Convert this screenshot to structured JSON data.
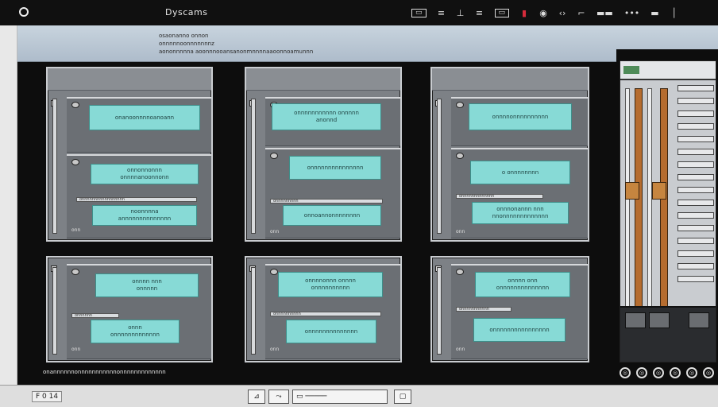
{
  "window": {
    "title": "Dyscams"
  },
  "toolbar": {
    "icons": [
      {
        "name": "layout-icon",
        "glyph": "▭"
      },
      {
        "name": "list-icon",
        "glyph": "≡"
      },
      {
        "name": "pin-icon",
        "glyph": "⊥"
      },
      {
        "name": "menu-icon",
        "glyph": "≡"
      },
      {
        "name": "window-icon",
        "glyph": "▭"
      },
      {
        "name": "record-icon",
        "glyph": "▮"
      },
      {
        "name": "eye-icon",
        "glyph": "◉"
      },
      {
        "name": "back-icon",
        "glyph": "‹›"
      },
      {
        "name": "flag-icon",
        "glyph": "⌐"
      },
      {
        "name": "dots-icon",
        "glyph": "▬▬"
      },
      {
        "name": "more-icon",
        "glyph": "•••"
      },
      {
        "name": "maximize-icon",
        "glyph": "▬"
      },
      {
        "name": "scroll-icon",
        "glyph": "│"
      }
    ]
  },
  "header": {
    "line1": "osaonanno onnon",
    "line2": "onnnnnoonnnnnnnz",
    "line3": "aononnnnna aoonnnooansanonmnnnnaaoonnoamunnn"
  },
  "cards": [
    {
      "top": "onanoonnnnoanoann",
      "mid": "onnonnonnn\nonnnnanoonnonn",
      "low": "noonnnna\nannnnnnnnnnnnnn",
      "strip": "onnnnnnnnnnnnnnnnn",
      "tiny": "onn"
    },
    {
      "top": "onnnnnnnnnnn onnnnn\nanonnd",
      "mid": "onnnnnnnnnnnnnnn",
      "low": "onnoannonnnnnnnn",
      "strip": "onnnnnnnnn",
      "tiny": "onn"
    },
    {
      "top": "onnnnonnnnnnnnnn",
      "mid": "o onnnnnnnn",
      "low": "onnnonannn nnn\nnnonnnnnnnnnnnnn",
      "strip": "onnnnnnnnnnnnn",
      "tiny": "onn"
    },
    {
      "top": "onnnn nnn\nonnnnn",
      "mid": "onnn\nonnnnnnnnnnnnn",
      "low": "",
      "strip": "onnnnnn",
      "tiny": "onn"
    },
    {
      "top": "onnnnonnn onnnn\nonnnnnnnnnn",
      "mid": "onnnnnnnnnnnnnn",
      "low": "",
      "strip": "onnnnnnnnnn",
      "tiny": "onn"
    },
    {
      "top": "onnnn onn\nonnnnnnnnnnnnnn",
      "mid": "onnnnnnnnnnnnnnnn",
      "low": "",
      "strip": "onnnnnnnnnnn",
      "tiny": "onn"
    }
  ],
  "caption": "onannnnnnonnnnnnnnnnnonnnnnnnnnnnnn",
  "controls": [
    "◎",
    "◎",
    "◎",
    "◎",
    "◎",
    "◎"
  ],
  "statusbar": {
    "text": "F 0 14",
    "tool1": "⊿",
    "tool2": "⤳",
    "tool3": "▭ ─────",
    "tool4": "▢"
  },
  "colors": {
    "accent_cyan": "#87dad6",
    "header_blue": "#aebccb",
    "canvas": "#0d0d0d",
    "rack_orange": "#b56c2f",
    "record_red": "#d62b3b"
  }
}
